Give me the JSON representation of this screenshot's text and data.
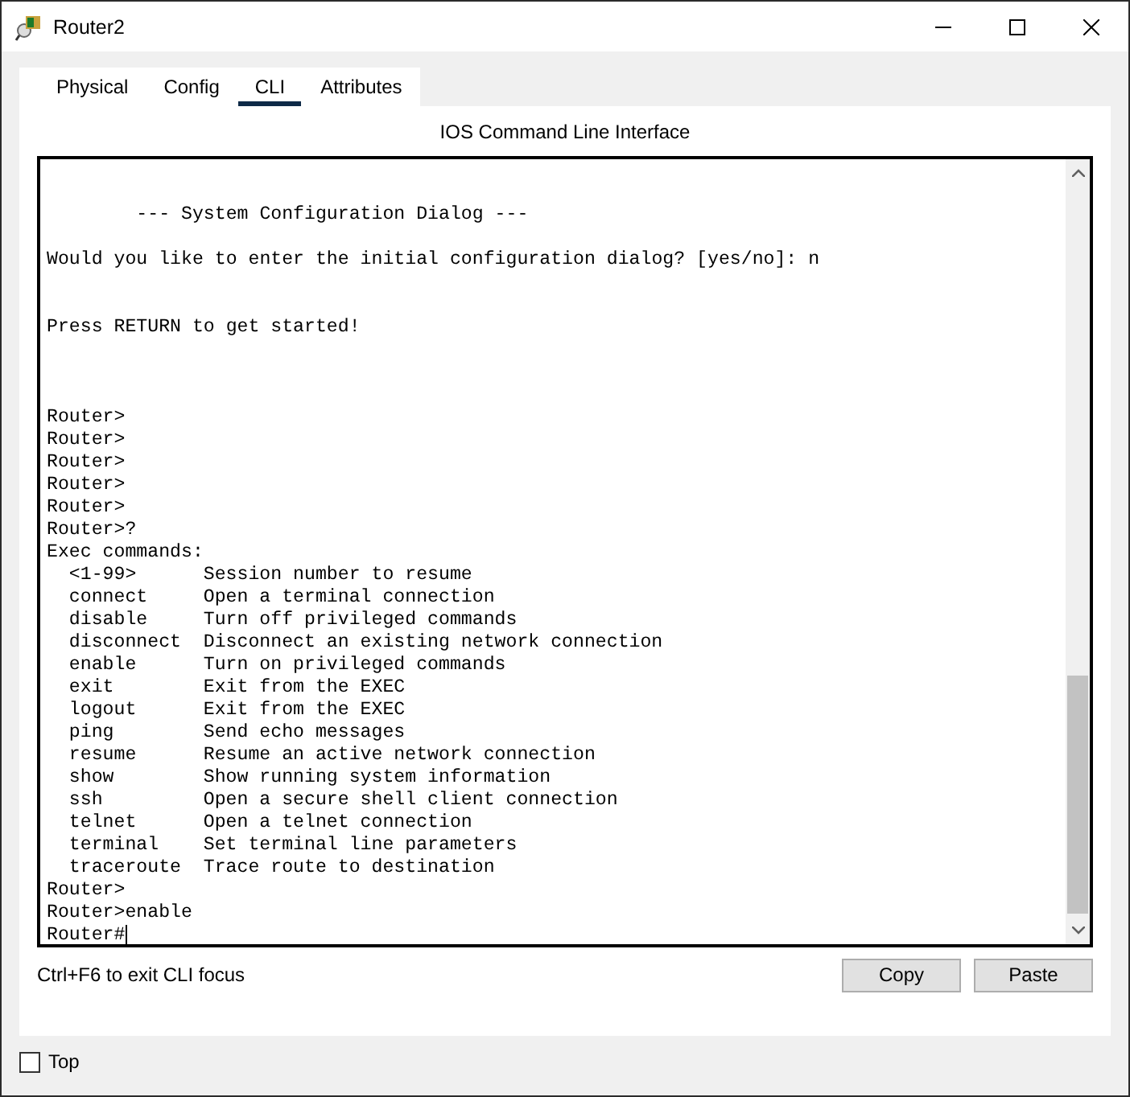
{
  "window": {
    "title": "Router2"
  },
  "tabs": [
    {
      "label": "Physical",
      "selected": false
    },
    {
      "label": "Config",
      "selected": false
    },
    {
      "label": "CLI",
      "selected": true
    },
    {
      "label": "Attributes",
      "selected": false
    }
  ],
  "panel_title": "IOS Command Line Interface",
  "terminal": {
    "lines": [
      {
        "kind": "blank"
      },
      {
        "kind": "blank"
      },
      {
        "kind": "text",
        "text": "        --- System Configuration Dialog ---"
      },
      {
        "kind": "blank"
      },
      {
        "kind": "text",
        "text": "Would you like to enter the initial configuration dialog? [yes/no]: n"
      },
      {
        "kind": "blank"
      },
      {
        "kind": "blank"
      },
      {
        "kind": "text",
        "text": "Press RETURN to get started!"
      },
      {
        "kind": "blank"
      },
      {
        "kind": "blank"
      },
      {
        "kind": "blank"
      },
      {
        "kind": "text",
        "text": "Router>"
      },
      {
        "kind": "text",
        "text": "Router>"
      },
      {
        "kind": "text",
        "text": "Router>"
      },
      {
        "kind": "text",
        "text": "Router>"
      },
      {
        "kind": "text",
        "text": "Router>"
      },
      {
        "kind": "text",
        "text": "Router>?"
      },
      {
        "kind": "text",
        "text": "Exec commands:"
      },
      {
        "kind": "command",
        "name": "<1-99>",
        "description": "Session number to resume"
      },
      {
        "kind": "command",
        "name": "connect",
        "description": "Open a terminal connection"
      },
      {
        "kind": "command",
        "name": "disable",
        "description": "Turn off privileged commands"
      },
      {
        "kind": "command",
        "name": "disconnect",
        "description": "Disconnect an existing network connection"
      },
      {
        "kind": "command",
        "name": "enable",
        "description": "Turn on privileged commands"
      },
      {
        "kind": "command",
        "name": "exit",
        "description": "Exit from the EXEC"
      },
      {
        "kind": "command",
        "name": "logout",
        "description": "Exit from the EXEC"
      },
      {
        "kind": "command",
        "name": "ping",
        "description": "Send echo messages"
      },
      {
        "kind": "command",
        "name": "resume",
        "description": "Resume an active network connection"
      },
      {
        "kind": "command",
        "name": "show",
        "description": "Show running system information"
      },
      {
        "kind": "command",
        "name": "ssh",
        "description": "Open a secure shell client connection"
      },
      {
        "kind": "command",
        "name": "telnet",
        "description": "Open a telnet connection"
      },
      {
        "kind": "command",
        "name": "terminal",
        "description": "Set terminal line parameters"
      },
      {
        "kind": "command",
        "name": "traceroute",
        "description": "Trace route to destination"
      },
      {
        "kind": "text",
        "text": "Router>"
      },
      {
        "kind": "text",
        "text": "Router>enable"
      },
      {
        "kind": "prompt",
        "text": "Router#"
      }
    ]
  },
  "hint": "Ctrl+F6 to exit CLI focus",
  "buttons": [
    "Copy",
    "Paste"
  ],
  "top_checkbox": {
    "label": "Top",
    "checked": false
  }
}
